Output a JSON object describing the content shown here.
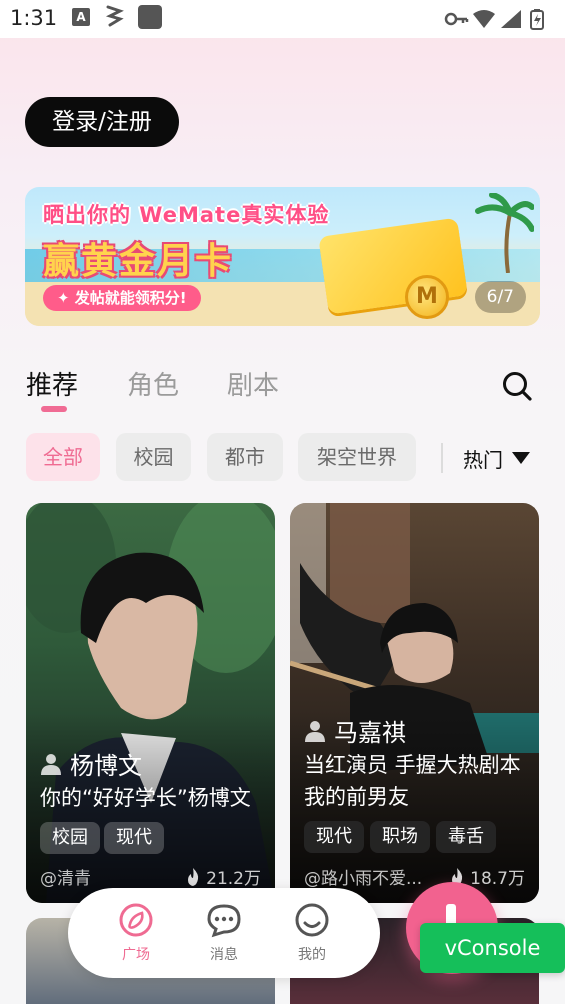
{
  "status_bar": {
    "time": "1:31",
    "notification_icon_letter": "A"
  },
  "auth": {
    "login_label": "登录/注册"
  },
  "banner": {
    "line1": "晒出你的 WeMate真实体验",
    "line2": "赢黄金月卡",
    "pill": "✦ 发帖就能领积分!",
    "coin_letter": "M",
    "counter": "6/7"
  },
  "tabs": [
    {
      "label": "推荐",
      "active": true
    },
    {
      "label": "角色",
      "active": false
    },
    {
      "label": "剧本",
      "active": false
    }
  ],
  "filters": [
    {
      "label": "全部",
      "active": true
    },
    {
      "label": "校园",
      "active": false
    },
    {
      "label": "都市",
      "active": false
    },
    {
      "label": "架空世界",
      "active": false
    }
  ],
  "sort": {
    "label": "热门"
  },
  "cards": [
    {
      "name": "杨博文",
      "description": "你的“好好学长”杨博文",
      "tags": [
        "校园",
        "现代"
      ],
      "author": "@清青",
      "heat": "21.2万"
    },
    {
      "name": "马嘉祺",
      "description": "当红演员 手握大热剧本 我的前男友",
      "tags": [
        "现代",
        "职场",
        "毒舌"
      ],
      "author": "@路小雨不爱...",
      "heat": "18.7万"
    }
  ],
  "bottom_nav": [
    {
      "label": "广场",
      "icon": "compass-icon",
      "active": true
    },
    {
      "label": "消息",
      "icon": "chat-bubble-icon",
      "active": false
    },
    {
      "label": "我的",
      "icon": "smiley-icon",
      "active": false
    }
  ],
  "vconsole": {
    "label": "vConsole"
  },
  "colors": {
    "accent": "#ef6b92",
    "vconsole": "#15bf5a",
    "fab": "#f2628f"
  }
}
